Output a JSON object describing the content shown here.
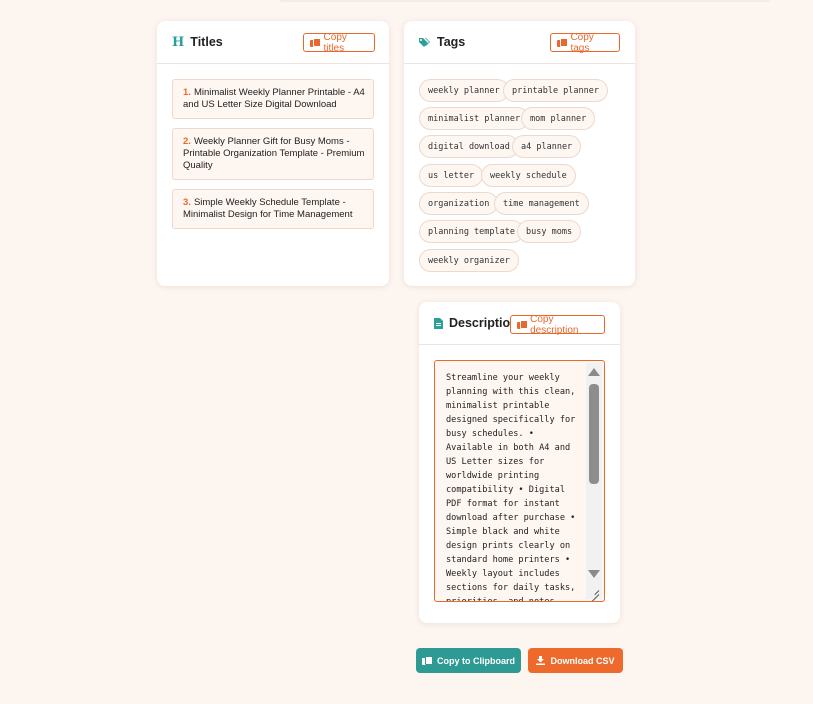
{
  "titles_card": {
    "heading": "Titles",
    "icon": "heading-icon",
    "copy_label": "Copy titles",
    "items": [
      {
        "num": "1.",
        "text": "Minimalist Weekly Planner Printable - A4 and US Letter Size Digital Download"
      },
      {
        "num": "2.",
        "text": "Weekly Planner Gift for Busy Moms - Printable Organization Template - Premium Quality"
      },
      {
        "num": "3.",
        "text": "Simple Weekly Schedule Template - Minimalist Design for Time Management"
      }
    ]
  },
  "tags_card": {
    "heading": "Tags",
    "icon": "tags-icon",
    "copy_label": "Copy tags",
    "tags": [
      "weekly planner",
      "printable planner",
      "minimalist planner",
      "mom planner",
      "digital download",
      "a4 planner",
      "us letter",
      "weekly schedule",
      "organization",
      "time management",
      "planning template",
      "busy moms",
      "weekly organizer"
    ]
  },
  "description_card": {
    "heading": "Description",
    "icon": "file-icon",
    "copy_label": "Copy description",
    "text": "Streamline your weekly planning with this clean, minimalist printable designed specifically for busy schedules. • Available in both A4 and US Letter sizes for worldwide printing compatibility • Digital PDF format for instant download after purchase • Simple black and white design prints clearly on standard home printers • Weekly layout includes sections for daily tasks, priorities, and notes"
  },
  "actions": {
    "copy_clipboard_label": "Copy to Clipboard",
    "download_csv_label": "Download CSV"
  },
  "colors": {
    "accent_orange": "#e8692c",
    "accent_teal": "#2d9a94",
    "background": "#fdf5f0"
  }
}
